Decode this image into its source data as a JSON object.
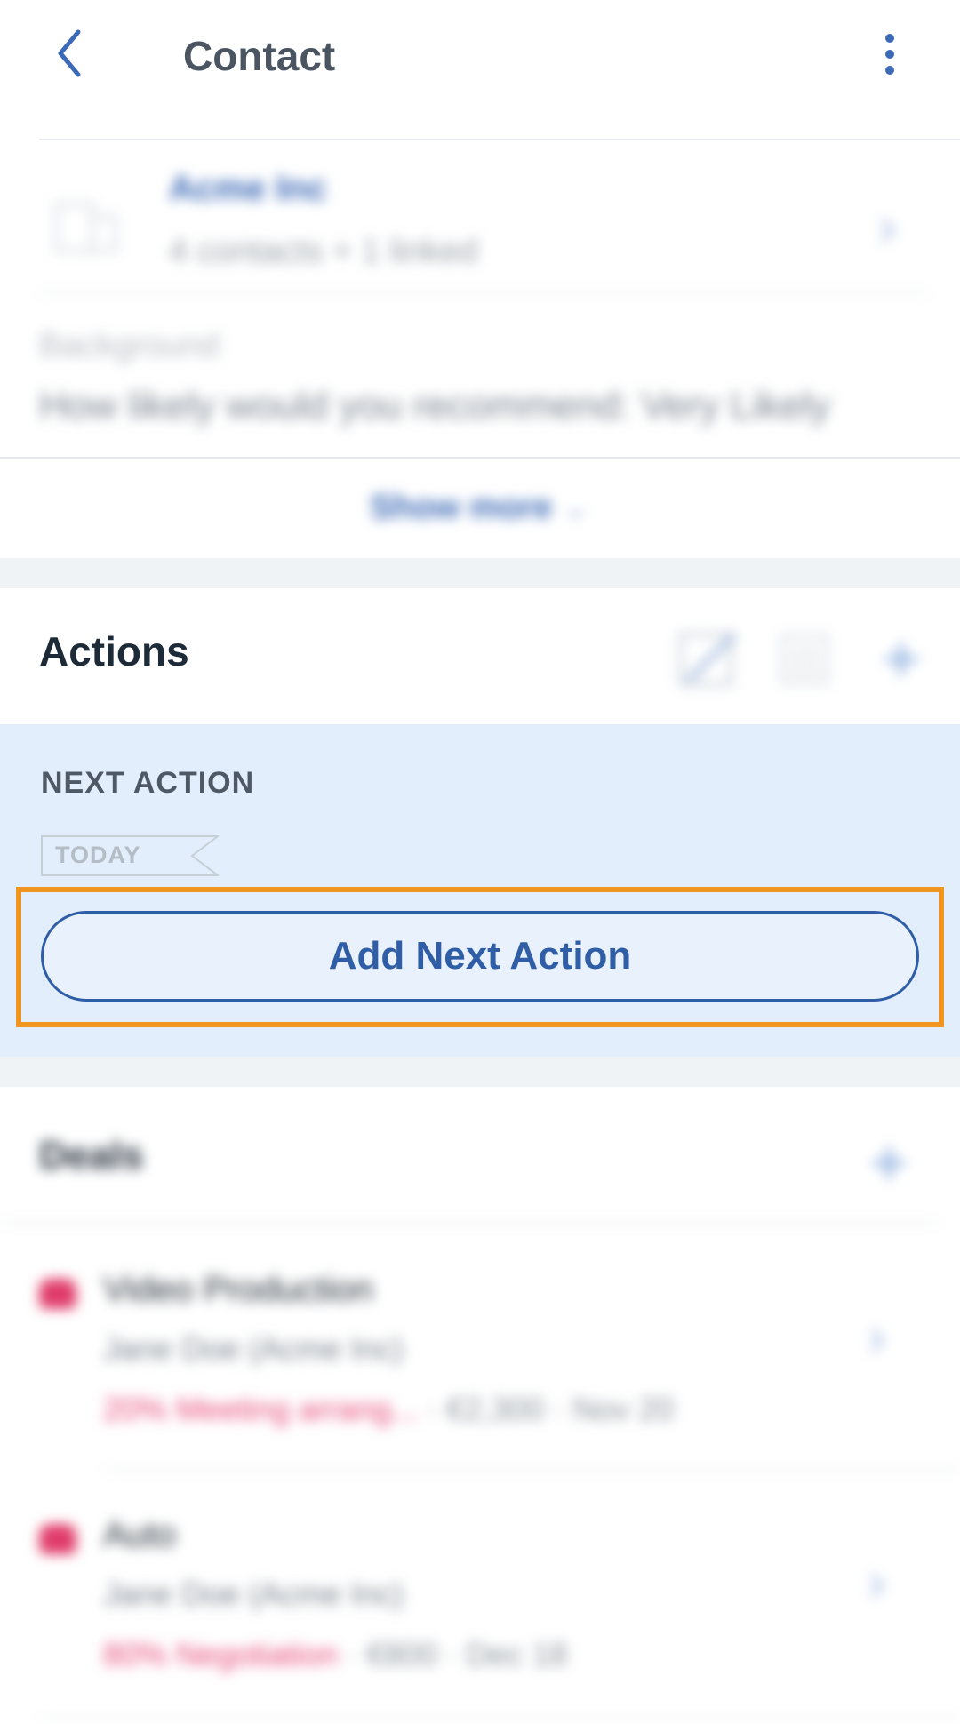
{
  "header": {
    "title": "Contact",
    "back_icon": "chevron-left-icon",
    "more_icon": "more-vertical-icon"
  },
  "account": {
    "name": "Acme Inc",
    "subtitle": "4 contacts + 1 linked"
  },
  "background": {
    "label": "Background",
    "value": "How likely would you recommend: Very Likely"
  },
  "show_more": {
    "label": "Show more",
    "icon": "chevron-down-icon"
  },
  "actions": {
    "title": "Actions",
    "next_action_label": "NEXT ACTION",
    "due_tag": "TODAY",
    "add_button_label": "Add Next Action"
  },
  "deals": {
    "title": "Deals",
    "items": [
      {
        "name": "Video Production",
        "contact": "Jane Doe (Acme Inc)",
        "stage": "20% Meeting arrang...",
        "amount": "€2,300",
        "date": "Nov 20"
      },
      {
        "name": "Auto",
        "contact": "Jane Doe (Acme Inc)",
        "stage": "80% Negotiation",
        "amount": "€800",
        "date": "Dec 18"
      }
    ]
  },
  "colors": {
    "accent": "#3d6ab7",
    "highlight": "#f0961f",
    "panel": "#e3eefc",
    "deal_stage": "#e6487a"
  }
}
